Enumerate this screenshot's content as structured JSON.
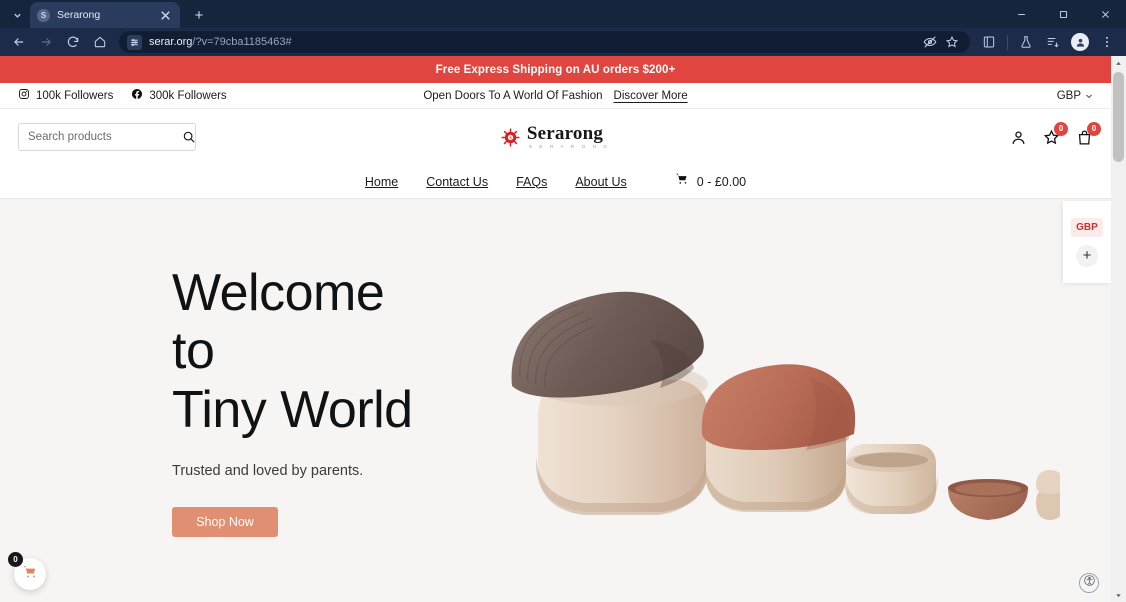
{
  "browser": {
    "tab": {
      "title": "Serarong",
      "favicon": "S",
      "close_icon": "close-icon"
    },
    "new_tab_label": "+",
    "window": {
      "minimize": "minimize-icon",
      "maximize": "maximize-icon",
      "close": "close-icon"
    },
    "nav": {
      "back": "back-icon",
      "forward": "forward-icon",
      "reload": "reload-icon",
      "home": "home-icon"
    },
    "omnibox": {
      "domain": "serar.org",
      "path": "/?v=79cba1185463#",
      "site_info_icon": "site-settings-icon",
      "tracking_icon": "tracking-protection-icon",
      "bookmark_icon": "star-icon"
    },
    "toolbar_icons": [
      "split-screen-icon",
      "labs-flask-icon",
      "reading-list-icon",
      "profile-avatar-icon",
      "three-dot-menu-icon"
    ]
  },
  "site": {
    "announcement": "Free Express Shipping on AU orders $200+",
    "topbar": {
      "socials": [
        {
          "icon": "instagram-icon",
          "label": "100k Followers"
        },
        {
          "icon": "facebook-icon",
          "label": "300k Followers"
        }
      ],
      "tagline": "Open Doors To A World Of Fashion",
      "link": "Discover More",
      "currency": "GBP",
      "currency_caret": "chevron-down-icon"
    },
    "header": {
      "search_placeholder": "Search products",
      "search_value": "",
      "search_icon": "search-icon",
      "brand_name": "Serarong",
      "brand_sub": "S E R A R O N G",
      "icons": [
        {
          "name": "account-icon",
          "badge": null
        },
        {
          "name": "wishlist-star-icon",
          "badge": "0"
        },
        {
          "name": "cart-bag-icon",
          "badge": "0"
        }
      ]
    },
    "nav": {
      "items": [
        "Home",
        "Contact Us",
        "FAQs",
        "About Us"
      ],
      "cart_icon": "shopping-cart-icon",
      "cart_total": "0 - £0.00"
    },
    "hero": {
      "heading_line1": "Welcome to",
      "heading_line2": "Tiny World",
      "subheading": "Trusted and loved by parents.",
      "cta": "Shop Now",
      "art_alt": "wooden-nesting-toys"
    },
    "currency_flyout": {
      "code": "GBP",
      "expand": "+"
    },
    "floating_cart": {
      "icon": "cart-icon",
      "badge": "0"
    },
    "accessibility": {
      "icon": "accessibility-icon"
    }
  },
  "colors": {
    "announcement_bg": "#e0453f",
    "hero_bg": "#f7f5f3",
    "cta_bg": "#e08f72",
    "badge_bg": "#e0453f",
    "chrome_bg": "#1c2b4a"
  }
}
